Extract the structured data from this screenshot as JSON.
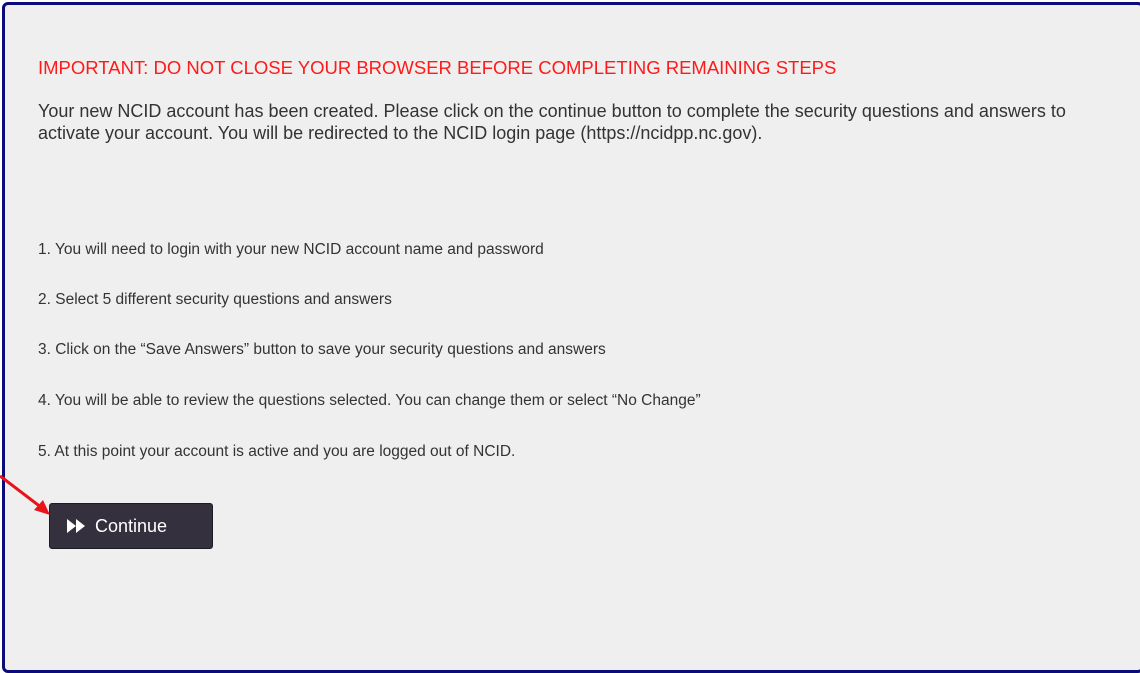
{
  "notice": {
    "important_text": "IMPORTANT: DO NOT CLOSE YOUR BROWSER BEFORE COMPLETING REMAINING STEPS",
    "intro_text": "Your new NCID account has been created. Please click on the continue button to complete the security questions and answers to activate your account. You will be redirected to the NCID login page (https://ncidpp.nc.gov)."
  },
  "steps": [
    "1. You will need to login with your new NCID account name and password",
    "2. Select 5 different security questions and answers",
    "3. Click on the “Save Answers” button to save your security questions and answers",
    "4. You will be able to review the questions selected. You can change them or select “No Change”",
    "5. At this point your account is active and you are logged out of NCID."
  ],
  "continue_button": {
    "label": "Continue",
    "icon": "fast-forward-icon"
  },
  "annotation": {
    "arrow_color": "#e8141c"
  },
  "colors": {
    "important": "#ff1a1a",
    "panel_border": "#0b0b7a",
    "panel_background": "#efefef",
    "button_background": "#35303e"
  }
}
